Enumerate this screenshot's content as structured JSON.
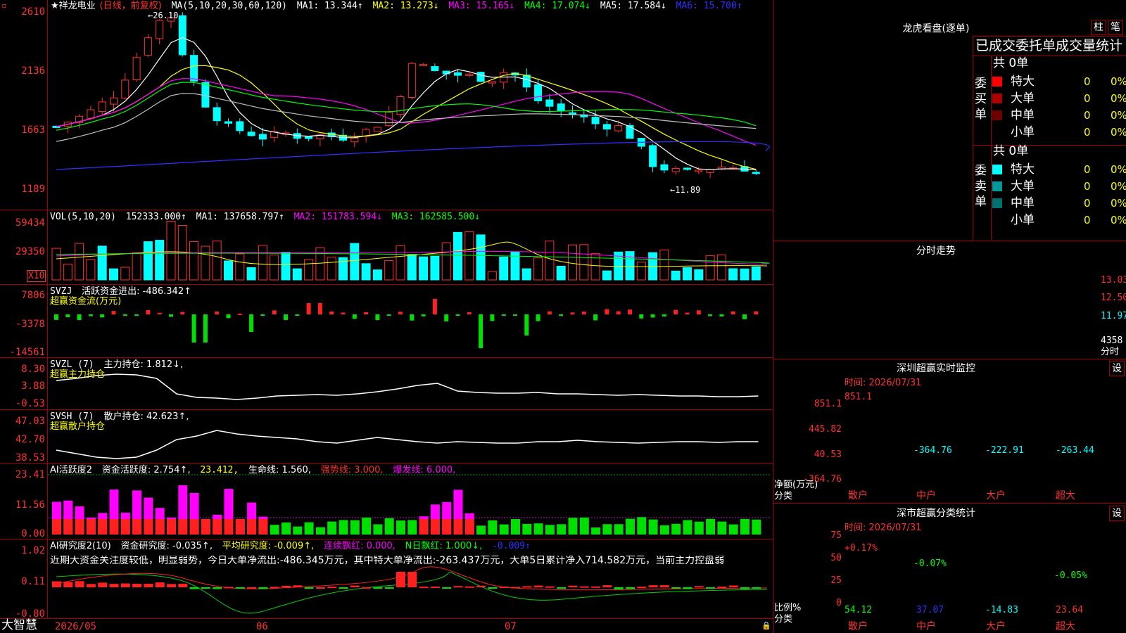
{
  "app": {
    "brand": "大智慧"
  },
  "header": {
    "stock_name": "★祥龙电业",
    "period_note": "(日线，前复权)",
    "ma_label": "MA(5,10,20,30,60,120)",
    "ma1": "MA1: 13.344↑",
    "ma2": "MA2: 13.273↓",
    "ma3": "MA3: 15.165↓",
    "ma4": "MA4: 17.074↓",
    "ma5": "MA5: 17.584↓",
    "ma6": "MA6: 15.700↑",
    "high_mark": "←26.10",
    "low_mark": "←11.89"
  },
  "price_axis": [
    "2610",
    "2136",
    "1663",
    "1189"
  ],
  "vol": {
    "label": "VOL(5,10,20)",
    "value": "152333.000↑",
    "ma1": "MA1: 137658.797↑",
    "ma2": "MA2: 151783.594↓",
    "ma3": "MA3: 162585.500↓",
    "axis": [
      "59434",
      "29350"
    ],
    "unit": "X10"
  },
  "svzj": {
    "label": "SVZJ",
    "name": "活跃资金进出: -486.342↑",
    "subtitle": "超赢资金流(万元)",
    "axis": [
      "7806",
      "-3378",
      "-14561"
    ]
  },
  "svzl": {
    "label": "SVZL (7)",
    "name": "主力持仓: 1.812↓,",
    "subtitle": "超赢主力持仓",
    "axis": [
      "8.30",
      "3.88",
      "-0.53"
    ]
  },
  "svsh": {
    "label": "SVSH (7)",
    "name": "散户持仓: 42.623↑,",
    "subtitle": "超赢散户持仓",
    "axis": [
      "47.03",
      "42.70",
      "38.53"
    ]
  },
  "ai1": {
    "label": "AI活跃度2",
    "name": "资金活跃度: 2.754↑,",
    "v2": "23.412,",
    "life": "生命线: 1.560,",
    "strong": "强势线: 3.000,",
    "burst": "爆发线: 6.000,",
    "axis": [
      "23.41",
      "11.56",
      "0.00"
    ]
  },
  "ai2": {
    "label": "AI研究度2(10)",
    "name": "资金研究度: -0.035↑,",
    "avg": "平均研究度: -0.009↑,",
    "lianxu": "连续飘红: 0.000,",
    "nday": "N日飘红: 1.000↓,",
    "last": "-0.009↑",
    "comment": "近期大资金关注度较低，明显弱势，今日大单净流出:-486.345万元，其中特大单净流出:-263.437万元，大单5日累计净入714.582万元，当前主力控盘弱",
    "axis": [
      "1.02",
      "0.11",
      "-0.80"
    ]
  },
  "date_axis": [
    "2026/05",
    "06",
    "07"
  ],
  "longhu": {
    "title": "龙虎看盘(逐单)",
    "btn1": "柱",
    "btn2": "笔",
    "header": "已成交委托单成交量统计",
    "buy": {
      "side": "委买单",
      "total": "共 0单",
      "rows": [
        {
          "name": "特大",
          "count": "0",
          "pct": "0%",
          "color": "#ff0000"
        },
        {
          "name": "大单",
          "count": "0",
          "pct": "0%",
          "color": "#aa0000"
        },
        {
          "name": "中单",
          "count": "0",
          "pct": "0%",
          "color": "#6e0000"
        },
        {
          "name": "小单",
          "count": "0",
          "pct": "0%",
          "color": "#000000"
        }
      ]
    },
    "sell": {
      "side": "委卖单",
      "total": "共 0单",
      "rows": [
        {
          "name": "特大",
          "count": "0",
          "pct": "0%",
          "color": "#00ffff"
        },
        {
          "name": "大单",
          "count": "0",
          "pct": "0%",
          "color": "#009a9a"
        },
        {
          "name": "中单",
          "count": "0",
          "pct": "0%",
          "color": "#007070"
        },
        {
          "name": "小单",
          "count": "0",
          "pct": "0%",
          "color": "#000000"
        }
      ]
    }
  },
  "intraday": {
    "title": "分时走势",
    "axis": [
      "13.03",
      "12.50",
      "11.97"
    ],
    "vol_axis": [
      "4358",
      "分时"
    ]
  },
  "monitor": {
    "title": "深圳超赢实时监控",
    "settings": "设",
    "time": "时间: 2026/07/31",
    "axis": [
      "851.1",
      "445.82",
      "40.53",
      "-364.76"
    ],
    "y_label": "净额(万元)",
    "x_label": "分类",
    "bars": [
      {
        "label": "散户",
        "value": "851.1"
      },
      {
        "label": "中户",
        "value": "-364.76"
      },
      {
        "label": "大户",
        "value": "-222.91"
      },
      {
        "label": "超大",
        "value": "-263.44"
      }
    ]
  },
  "stats": {
    "title": "深市超赢分类统计",
    "settings": "设",
    "time": "时间: 2026/07/31",
    "axis": [
      "75",
      "50",
      "25",
      "0"
    ],
    "y_label": "比例%",
    "x_label": "分类",
    "bars": [
      {
        "label": "散户",
        "top": "+0.17%",
        "bottom": "54.12"
      },
      {
        "label": "中户",
        "top": "-0.07%",
        "bottom": "37.07"
      },
      {
        "label": "大户",
        "top": "",
        "bottom": "-14.83"
      },
      {
        "label": "超大",
        "top": "-0.05%",
        "bottom": "23.64"
      }
    ]
  },
  "chart_data": {
    "type": "candlestick",
    "x_range": [
      "2026/05",
      "2026/07"
    ],
    "y_axis_ticks": [
      "2610",
      "2136",
      "1663",
      "1189"
    ],
    "high": 26.1,
    "low": 11.89,
    "ma": {
      "MA1": 13.344,
      "MA2": 13.273,
      "MA3": 15.165,
      "MA4": 17.074,
      "MA5": 17.584,
      "MA6": 15.7
    }
  }
}
